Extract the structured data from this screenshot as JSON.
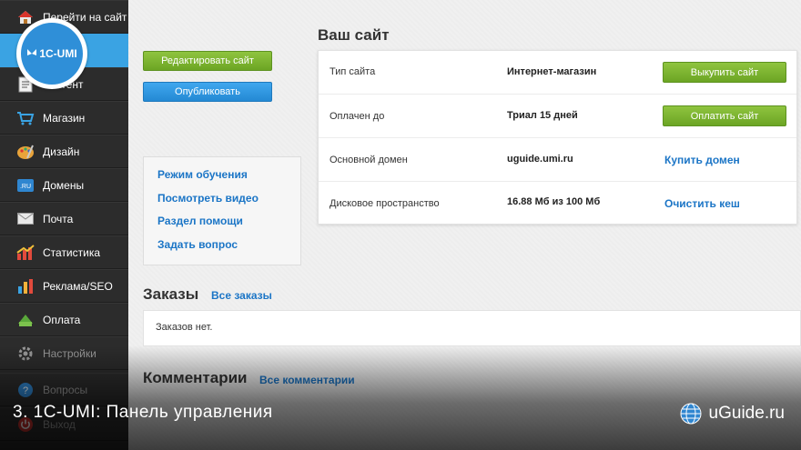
{
  "sidebar": {
    "logo_text": "1C-UMI",
    "items": [
      {
        "label": "Перейти на сайт"
      },
      {
        "label": "Контент"
      },
      {
        "label": "Магазин"
      },
      {
        "label": "Дизайн"
      },
      {
        "label": "Домены"
      },
      {
        "label": "Почта"
      },
      {
        "label": "Статистика"
      },
      {
        "label": "Реклама/SEO"
      },
      {
        "label": "Оплата"
      },
      {
        "label": "Настройки"
      },
      {
        "label": "Вопросы"
      },
      {
        "label": "Выход"
      }
    ]
  },
  "actions": {
    "edit_label": "Редактировать сайт",
    "publish_label": "Опубликовать"
  },
  "help_links": [
    "Режим обучения",
    "Посмотреть видео",
    "Раздел помощи",
    "Задать вопрос"
  ],
  "site": {
    "title": "Ваш сайт",
    "rows": [
      {
        "label": "Тип сайта",
        "value": "Интернет-магазин",
        "action": "Выкупить сайт"
      },
      {
        "label": "Оплачен до",
        "value": "Триал 15 дней",
        "action": "Оплатить сайт"
      },
      {
        "label": "Основной домен",
        "value": "uguide.umi.ru",
        "action": "Купить домен"
      },
      {
        "label": "Дисковое пространство",
        "value": "16.88 Мб из 100 Мб",
        "action": "Очистить кеш"
      }
    ]
  },
  "orders": {
    "title": "Заказы",
    "all_link": "Все заказы",
    "empty_text": "Заказов нет."
  },
  "comments": {
    "title": "Комментарии",
    "all_link": "Все комментарии"
  },
  "overlay": {
    "caption": "3. 1C-UMI: Панель управления",
    "brand": "uGuide.ru"
  },
  "colors": {
    "sidebar_bg": "#2c2c2c",
    "active_blue": "#3aa3e3",
    "green_button": "#7bb431",
    "blue_button": "#2d97e2",
    "link": "#1b75c6"
  }
}
